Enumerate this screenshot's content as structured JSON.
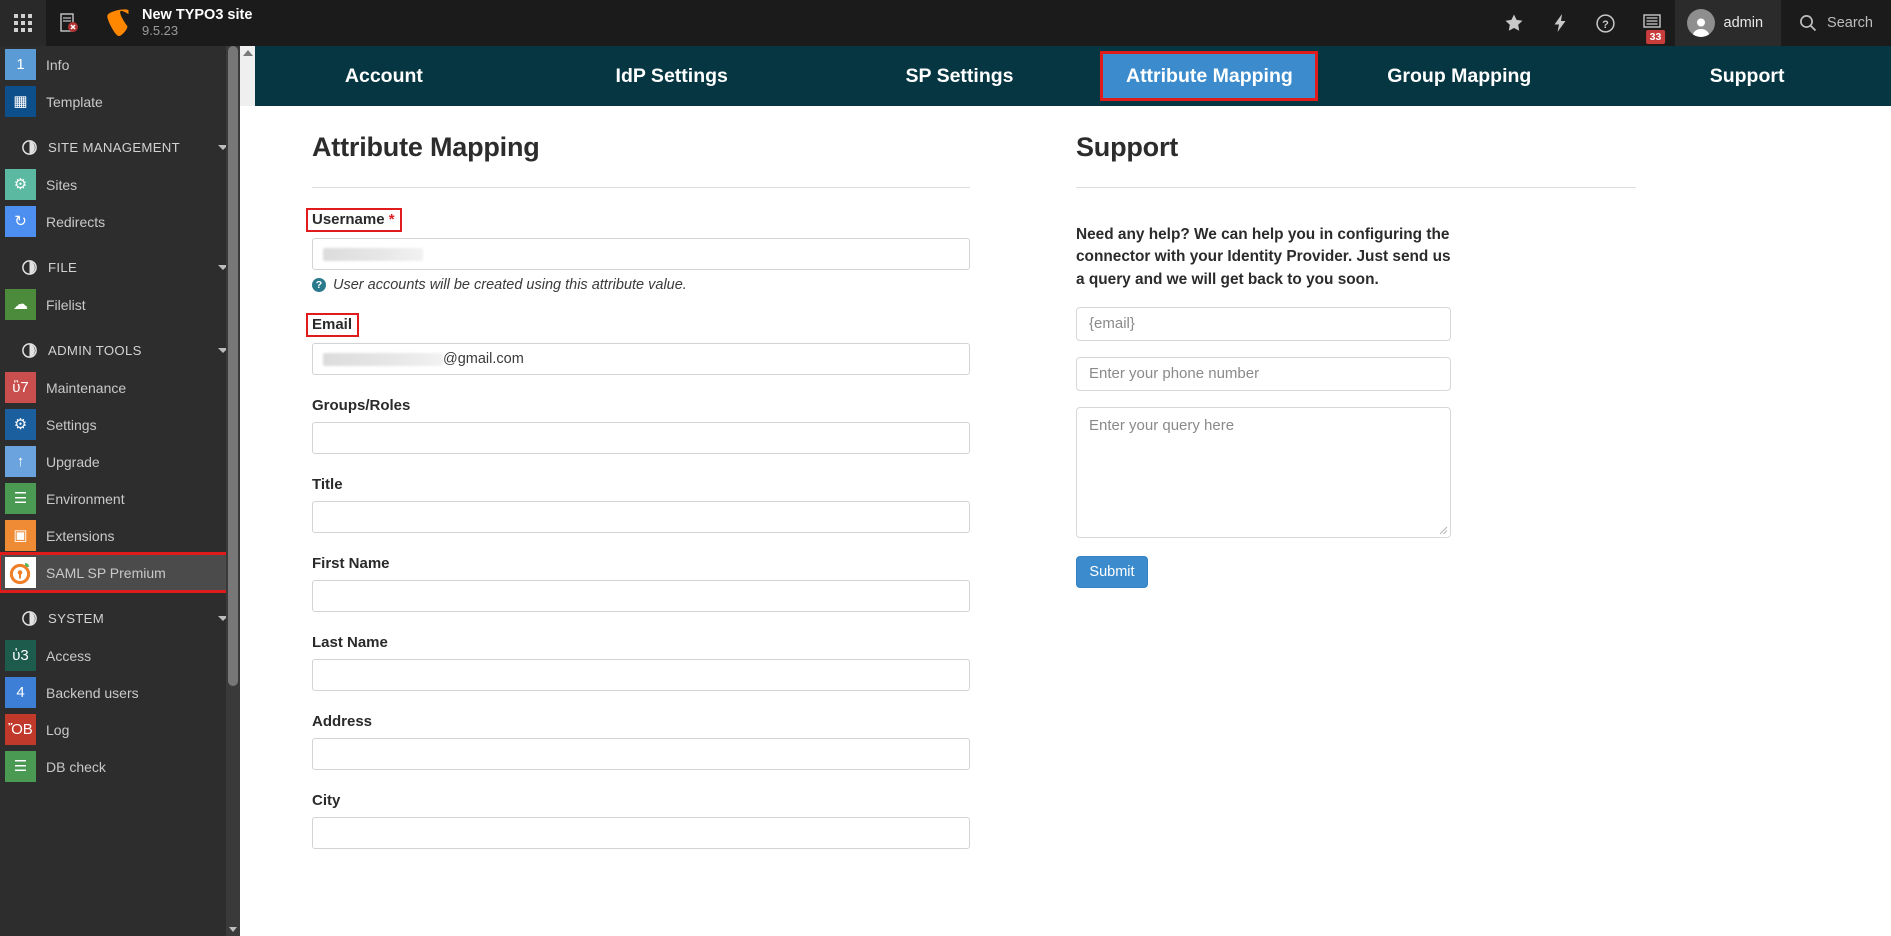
{
  "topbar": {
    "site_name": "New TYPO3 site",
    "version": "9.5.23",
    "user_name": "admin",
    "search_label": "Search",
    "notification_count": "33",
    "icons": {
      "modules": "grid-apps-icon",
      "clear_cache": "clear-cache-icon",
      "bookmark": "star-icon",
      "flash": "lightning-icon",
      "help": "help-circle-icon",
      "list": "list-badge-icon",
      "search": "search-icon"
    }
  },
  "sidebar": {
    "items": [
      {
        "label": "Info",
        "type": "item",
        "color": "#5a9bd5",
        "glyph": "1"
      },
      {
        "label": "Template",
        "type": "item",
        "color": "#0d4f8b",
        "glyph": "▦"
      },
      {
        "label": "SITE MANAGEMENT",
        "type": "section",
        "glyph": "◑"
      },
      {
        "label": "Sites",
        "type": "item",
        "color": "#5ab9a0",
        "glyph": "⚙"
      },
      {
        "label": "Redirects",
        "type": "item",
        "color": "#4d8ff0",
        "glyph": "↻"
      },
      {
        "label": "FILE",
        "type": "section",
        "glyph": "ὛC"
      },
      {
        "label": "Filelist",
        "type": "item",
        "color": "#4b8b3b",
        "glyph": "☁"
      },
      {
        "label": "ADMIN TOOLS",
        "type": "section",
        "glyph": "Ὠ0"
      },
      {
        "label": "Maintenance",
        "type": "item",
        "color": "#c94f4f",
        "glyph": "ὒ7"
      },
      {
        "label": "Settings",
        "type": "item",
        "color": "#1c5f9e",
        "glyph": "⚙"
      },
      {
        "label": "Upgrade",
        "type": "item",
        "color": "#6aa3dd",
        "glyph": "↑"
      },
      {
        "label": "Environment",
        "type": "item",
        "color": "#4a9a54",
        "glyph": "☰"
      },
      {
        "label": "Extensions",
        "type": "item",
        "color": "#ef8b35",
        "glyph": "▣"
      },
      {
        "label": "SAML SP Premium",
        "type": "item",
        "color": "#ffffff",
        "glyph": "◎",
        "active": true,
        "annotated": true
      },
      {
        "label": "SYSTEM",
        "type": "section",
        "glyph": "ὐC"
      },
      {
        "label": "Access",
        "type": "item",
        "color": "#1d5c4d",
        "glyph": "ὑ3"
      },
      {
        "label": "Backend users",
        "type": "item",
        "color": "#3d7fd6",
        "glyph": "὆4"
      },
      {
        "label": "Log",
        "type": "item",
        "color": "#c0392b",
        "glyph": "ὌB"
      },
      {
        "label": "DB check",
        "type": "item",
        "color": "#4a9a54",
        "glyph": "☰"
      }
    ]
  },
  "tabs": [
    {
      "label": "Account",
      "active": false
    },
    {
      "label": "IdP Settings",
      "active": false
    },
    {
      "label": "SP Settings",
      "active": false
    },
    {
      "label": "Attribute Mapping",
      "active": true,
      "annotated": true
    },
    {
      "label": "Group Mapping",
      "active": false
    },
    {
      "label": "Support",
      "active": false
    }
  ],
  "attribute_mapping": {
    "title": "Attribute Mapping",
    "fields": [
      {
        "label": "Username",
        "required": true,
        "annotated": true,
        "value": "",
        "redacted": true,
        "redact_width": 100,
        "hint": "User accounts will be created using this attribute value."
      },
      {
        "label": "Email",
        "required": false,
        "annotated": true,
        "value": "@gmail.com",
        "redacted": true,
        "redact_width": 120,
        "hint": ""
      },
      {
        "label": "Groups/Roles",
        "required": false,
        "annotated": false,
        "value": "",
        "redacted": false,
        "hint": ""
      },
      {
        "label": "Title",
        "required": false,
        "annotated": false,
        "value": "",
        "redacted": false,
        "hint": ""
      },
      {
        "label": "First Name",
        "required": false,
        "annotated": false,
        "value": "",
        "redacted": false,
        "hint": ""
      },
      {
        "label": "Last Name",
        "required": false,
        "annotated": false,
        "value": "",
        "redacted": false,
        "hint": ""
      },
      {
        "label": "Address",
        "required": false,
        "annotated": false,
        "value": "",
        "redacted": false,
        "hint": ""
      },
      {
        "label": "City",
        "required": false,
        "annotated": false,
        "value": "",
        "redacted": false,
        "hint": ""
      }
    ]
  },
  "support": {
    "title": "Support",
    "description": "Need any help? We can help you in configuring the connector with your Identity Provider. Just send us a query and we will get back to you soon.",
    "email_placeholder": "{email}",
    "phone_placeholder": "Enter your phone number",
    "query_placeholder": "Enter your query here",
    "submit_label": "Submit"
  },
  "colors": {
    "accent_blue": "#3c8ccd",
    "nav_teal": "#063642",
    "annotation_red": "#e01b1b",
    "topbar_dark": "#1b1b1b",
    "sidebar_dark": "#2d2d2d"
  }
}
